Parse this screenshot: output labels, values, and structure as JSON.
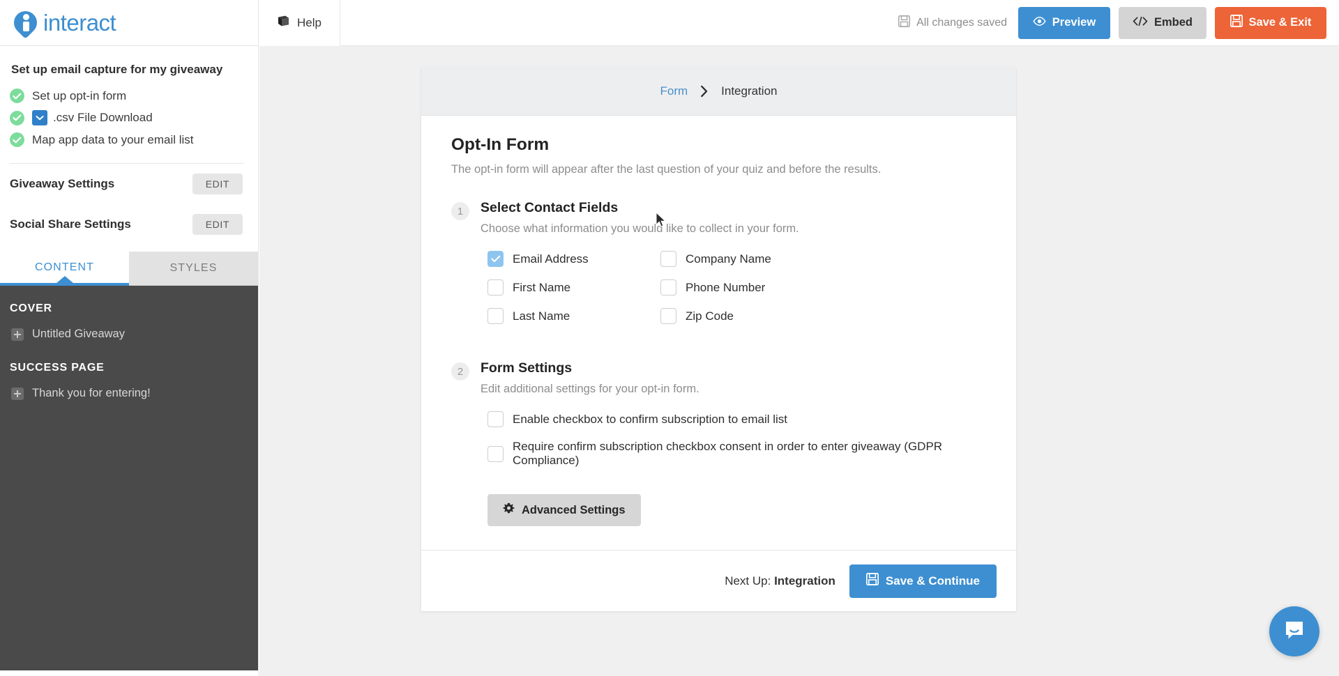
{
  "header": {
    "brand_name": "interact",
    "brand_color": "#3d8fd1",
    "help_label": "Help",
    "help_icon": "book-icon",
    "saved_status": "All changes saved",
    "saved_icon": "floppy-disk-icon",
    "buttons": [
      {
        "label": "Preview",
        "icon": "eye-icon",
        "color": "#3d8fd1"
      },
      {
        "label": "Embed",
        "icon": "code-icon",
        "color": "#d4d4d4"
      },
      {
        "label": "Save & Exit",
        "icon": "floppy-disk-icon",
        "color": "#ec6437"
      }
    ]
  },
  "sidebar": {
    "title": "Set up email capture for my giveaway",
    "tasks": [
      {
        "label": "Set up opt-in form",
        "done": true,
        "chip": false
      },
      {
        "label": ".csv File Download",
        "done": true,
        "chip": true,
        "chip_icon": "chevron-down-icon"
      },
      {
        "label": "Map app data to your email list",
        "done": true,
        "chip": false
      }
    ],
    "settings": [
      {
        "label": "Giveaway Settings",
        "action": "EDIT"
      },
      {
        "label": "Social Share Settings",
        "action": "EDIT"
      }
    ],
    "tabs": [
      {
        "label": "CONTENT",
        "active": true
      },
      {
        "label": "STYLES",
        "active": false
      }
    ],
    "sections": [
      {
        "heading": "COVER",
        "items": [
          {
            "label": "Untitled Giveaway",
            "icon": "plus-box-icon"
          }
        ]
      },
      {
        "heading": "SUCCESS PAGE",
        "items": [
          {
            "label": "Thank you for entering!",
            "icon": "plus-box-icon"
          }
        ]
      }
    ]
  },
  "card": {
    "breadcrumb": {
      "link": "Form",
      "separator_icon": "chevron-right-icon",
      "current": "Integration"
    },
    "title": "Opt-In Form",
    "subtitle": "The opt-in form will appear after the last question of your quiz and before the results.",
    "step1": {
      "number": "1",
      "title": "Select Contact Fields",
      "subtitle": "Choose what information you would like to collect in your form.",
      "fields": [
        {
          "label": "Email Address",
          "checked": true
        },
        {
          "label": "Company Name",
          "checked": false
        },
        {
          "label": "First Name",
          "checked": false
        },
        {
          "label": "Phone Number",
          "checked": false
        },
        {
          "label": "Last Name",
          "checked": false
        },
        {
          "label": "Zip Code",
          "checked": false
        }
      ]
    },
    "step2": {
      "number": "2",
      "title": "Form Settings",
      "subtitle": "Edit additional settings for your opt-in form.",
      "options": [
        {
          "label": "Enable checkbox to confirm subscription to email list",
          "checked": false
        },
        {
          "label": "Require confirm subscription checkbox consent in order to enter giveaway (GDPR Compliance)",
          "checked": false
        }
      ],
      "advanced_button": {
        "label": "Advanced Settings",
        "icon": "gear-icon"
      }
    },
    "footer": {
      "next_up_prefix": "Next Up: ",
      "next_up_value": "Integration",
      "save_continue": {
        "label": "Save & Continue",
        "icon": "floppy-disk-icon",
        "color": "#3d8fd1"
      }
    }
  },
  "intercom": {
    "icon": "chat-bubble-icon",
    "color": "#3d8fd1"
  }
}
